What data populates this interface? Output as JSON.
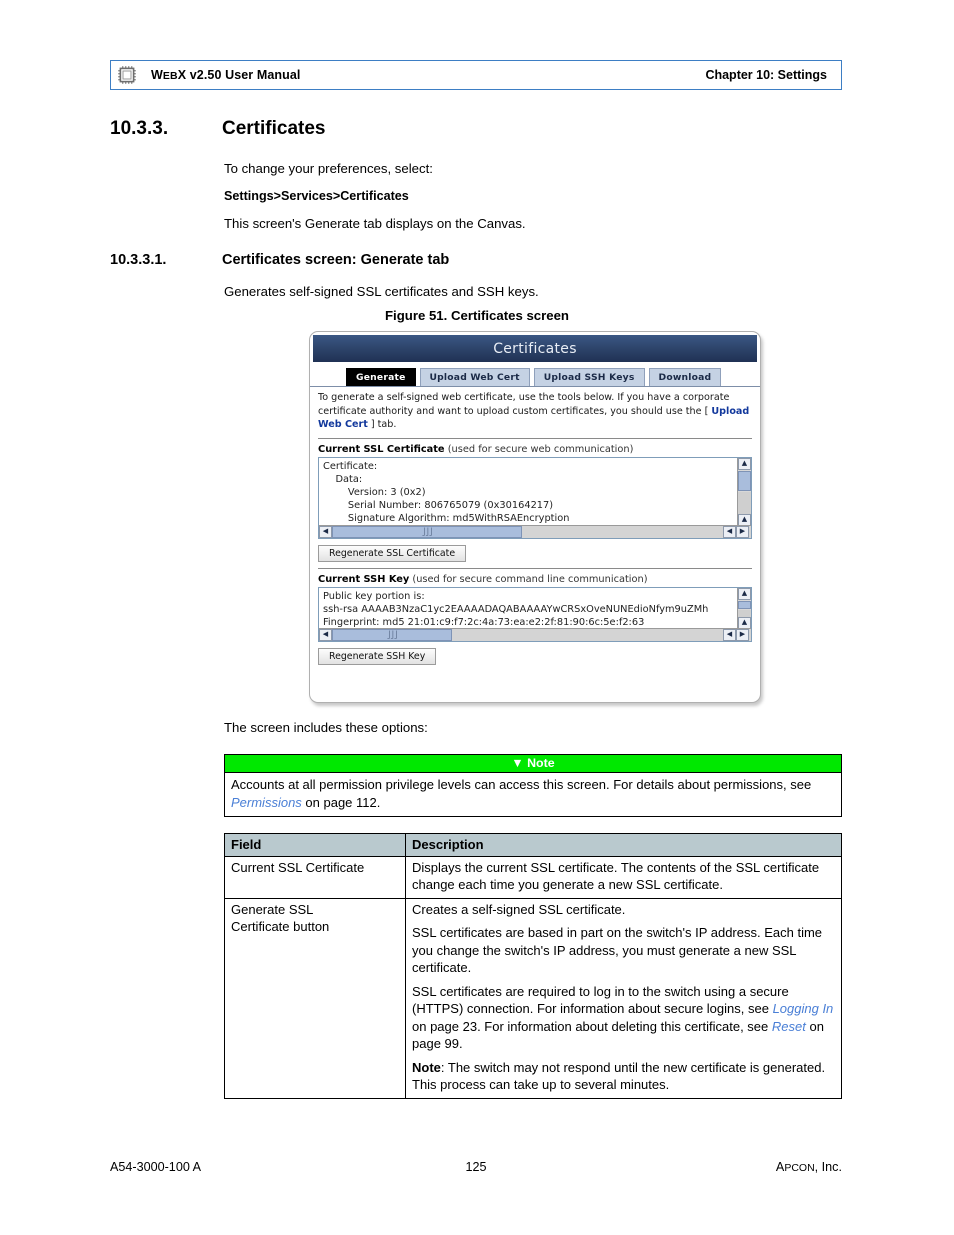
{
  "header": {
    "icon": "microchip-icon",
    "title_prefix": "W",
    "title_smallcaps": "EB",
    "title_rest": "X v2.50 User Manual",
    "chapter": "Chapter 10: Settings"
  },
  "section": {
    "number": "10.3.3.",
    "title": "Certificates",
    "intro": "To change your preferences, select:",
    "breadcrumb": "Settings>Services>Certificates",
    "canvas_note": "This screen's Generate tab displays on the Canvas."
  },
  "subsection": {
    "number": "10.3.3.1.",
    "title": "Certificates screen: Generate tab",
    "description": "Generates  self-signed SSL certificates and SSH keys."
  },
  "figure": {
    "caption": "Figure 51. Certificates screen",
    "window_title": "Certificates",
    "tabs": [
      {
        "label": "Generate",
        "active": true
      },
      {
        "label": "Upload Web Cert",
        "active": false
      },
      {
        "label": "Upload SSH Keys",
        "active": false
      },
      {
        "label": "Download",
        "active": false
      }
    ],
    "intro_part1": "To generate a self-signed web certificate, use the tools below. If you have a corporate certificate authority and want to upload custom certificates, you should use the [ ",
    "intro_link": "Upload Web Cert",
    "intro_part2": " ] tab.",
    "ssl": {
      "label_bold": "Current SSL Certificate",
      "label_rest": " (used for secure web communication)",
      "content": "Certificate:\n    Data:\n        Version: 3 (0x2)\n        Serial Number: 806765079 (0x30164217)\n        Signature Algorithm: md5WithRSAEncryption",
      "button": "Regenerate SSL Certificate"
    },
    "ssh": {
      "label_bold": "Current SSH Key",
      "label_rest": " (used for secure command line communication)",
      "content": "Public key portion is:\nssh-rsa AAAAB3NzaC1yc2EAAAADAQABAAAAYwCRSxOveNUNEdioNfym9uZMh\nFingerprint: md5 21:01:c9:f7:2c:4a:73:ea:e2:2f:81:90:6c:5e:f2:63",
      "button": "Regenerate SSH Key"
    }
  },
  "options_intro": "The screen includes these options:",
  "note": {
    "icon": "warning-icon",
    "heading": "Note",
    "text_part1": "Accounts at all permission privilege levels can access this screen. For details about permissions, see ",
    "link": "Permissions",
    "text_part2": " on page 112."
  },
  "table": {
    "headers": [
      "Field",
      "Description"
    ],
    "rows": [
      {
        "field": "Current SSL Certificate",
        "paragraphs": [
          {
            "text": "Displays the current SSL certificate. The contents of the SSL certificate change each time you generate a new SSL certificate."
          }
        ]
      },
      {
        "field": "Generate SSL\nCertificate button",
        "paragraphs": [
          {
            "text": "Creates a self-signed SSL certificate."
          },
          {
            "text": "SSL certificates are based in part on the switch's IP address. Each time you change the switch's IP address, you must generate a new SSL certificate."
          },
          {
            "text": "SSL certificates are required to log in to the switch using a secure (HTTPS) connection. For information about secure logins, see Logging In on page 23. For information about deleting this certificate, see Reset on page 99.",
            "links": [
              "Logging In",
              "Reset"
            ]
          },
          {
            "text": "Note: The switch may not respond until the new certificate is generated. This process can take up to several minutes.",
            "bold_prefix": "Note"
          }
        ]
      }
    ]
  },
  "footer": {
    "doc_number": "A54-3000-100 A",
    "page_number": "125",
    "company_prefix": "A",
    "company_smallcaps": "PCON",
    "company_rest": ", Inc."
  }
}
